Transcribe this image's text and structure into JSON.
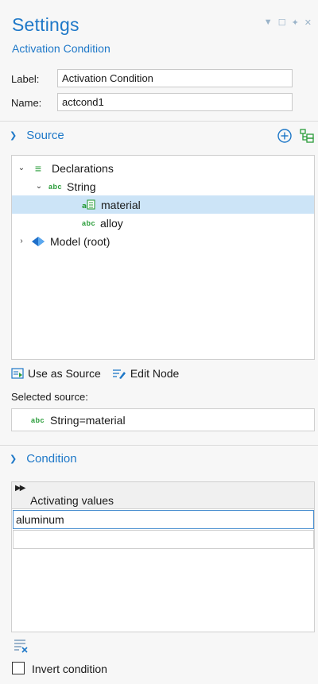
{
  "header": {
    "title": "Settings",
    "subtitle": "Activation Condition"
  },
  "fields": {
    "label_caption": "Label:",
    "label_value": "Activation Condition",
    "name_caption": "Name:",
    "name_value": "actcond1"
  },
  "source_section": {
    "title": "Source",
    "tree": [
      {
        "label": "Declarations",
        "icon": "declarations-icon",
        "depth": 0,
        "expanded": true
      },
      {
        "label": "String",
        "icon": "abc-icon",
        "depth": 1,
        "expanded": true
      },
      {
        "label": "material",
        "icon": "variable-icon",
        "depth": 2,
        "selected": true
      },
      {
        "label": "alloy",
        "icon": "abc-icon",
        "depth": 2
      },
      {
        "label": "Model (root)",
        "icon": "model-icon",
        "depth": 0,
        "expanded": false
      }
    ],
    "use_as_source_label": "Use as Source",
    "edit_node_label": "Edit Node",
    "selected_source_caption": "Selected source:",
    "selected_source_value": "String=material"
  },
  "condition_section": {
    "title": "Condition",
    "table_header": "Activating values",
    "rows": [
      "aluminum",
      ""
    ],
    "invert_label": "Invert condition",
    "invert_checked": false
  },
  "colors": {
    "accent": "#1e78c8",
    "selection": "#cce4f7",
    "icon_green": "#2a9d3a"
  }
}
